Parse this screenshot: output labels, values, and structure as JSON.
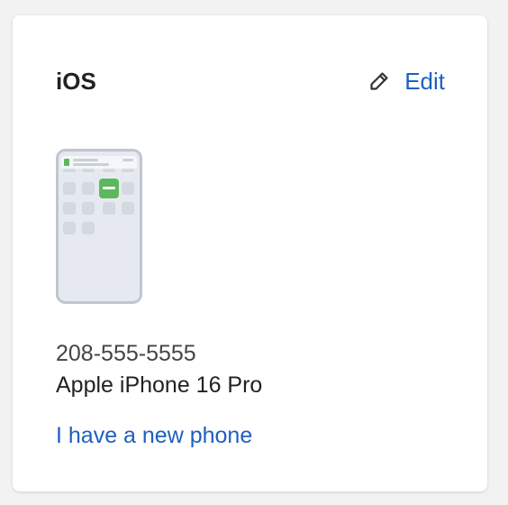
{
  "card": {
    "title": "iOS",
    "edit_label": "Edit",
    "phone_number": "208-555-5555",
    "device_model": "Apple iPhone 16 Pro",
    "new_phone_link": "I have a new phone",
    "icons": {
      "edit": "pencil-icon",
      "device": "phone-illustration"
    },
    "colors": {
      "link": "#1f5fbf",
      "app_badge": "#5cb85c"
    }
  }
}
